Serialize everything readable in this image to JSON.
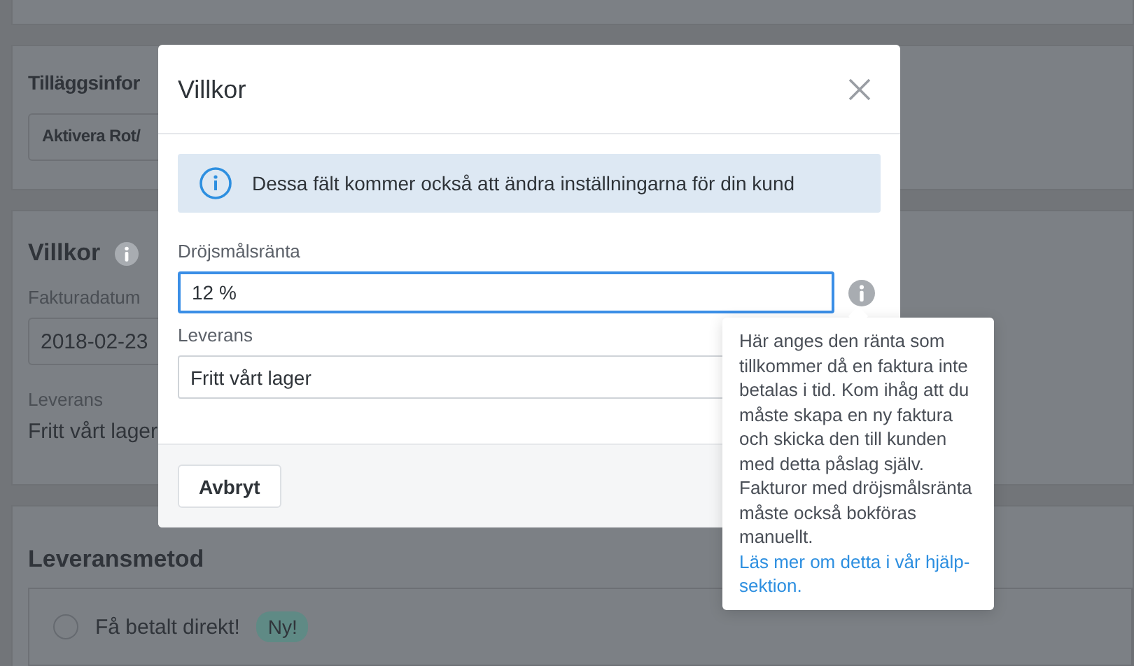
{
  "page": {
    "extra_info": {
      "title": "Tilläggsinfor",
      "button": "Aktivera Rot/"
    },
    "terms": {
      "title": "Villkor",
      "date_label": "Fakturadatum",
      "date_value": "2018-02-23",
      "delivery_label": "Leverans",
      "delivery_value": "Fritt vårt lager"
    },
    "delivery_method": {
      "title": "Leveransmetod",
      "options": [
        {
          "label": "Få betalt direkt!",
          "badge": "Ny!",
          "selected": false
        }
      ]
    }
  },
  "dialog": {
    "title": "Villkor",
    "notice": "Dessa fält kommer också att ändra inställningarna för din kund",
    "fields": [
      {
        "label": "Dröjsmålsränta",
        "value": "12 %",
        "focused": true,
        "info": true
      },
      {
        "label": "Leverans",
        "value": "Fritt vårt lager",
        "focused": false
      }
    ],
    "buttons": [
      "Avbryt"
    ],
    "tooltip": {
      "text": "Här anges den ränta som tillkommer då en faktura inte betalas i tid. Kom ihåg att du måste skapa en ny faktura och skicka den till kunden med detta påslag själv. Fakturor med dröjsmålsränta måste också bokföras manuellt.",
      "link": "Läs mer om detta i vår hjälp-sektion."
    }
  }
}
